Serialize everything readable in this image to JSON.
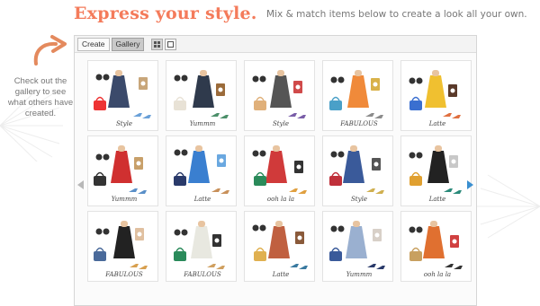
{
  "header": {
    "headline": "Express your style.",
    "subhead": "Mix & match items below to create a look all your own."
  },
  "sidebar": {
    "note": "Check out the gallery to see what others have created."
  },
  "toolbar": {
    "tabs": [
      {
        "label": "Create",
        "active": false
      },
      {
        "label": "Gallery",
        "active": true
      }
    ],
    "view_buttons": [
      {
        "icon": "grid-view-icon",
        "active": true
      },
      {
        "icon": "single-view-icon",
        "active": false
      }
    ]
  },
  "gallery": {
    "rows": 3,
    "columns": 5,
    "items": [
      {
        "icon": "outfit-thumbnail-1",
        "caption": "Style"
      },
      {
        "icon": "outfit-thumbnail-2",
        "caption": "Yummm"
      },
      {
        "icon": "outfit-thumbnail-3",
        "caption": "Style"
      },
      {
        "icon": "outfit-thumbnail-4",
        "caption": "FABULOUS"
      },
      {
        "icon": "outfit-thumbnail-5",
        "caption": "Latte"
      },
      {
        "icon": "outfit-thumbnail-6",
        "caption": "Yummm"
      },
      {
        "icon": "outfit-thumbnail-7",
        "caption": "Latte"
      },
      {
        "icon": "outfit-thumbnail-8",
        "caption": "ooh la la"
      },
      {
        "icon": "outfit-thumbnail-9",
        "caption": "Style"
      },
      {
        "icon": "outfit-thumbnail-10",
        "caption": "Latte"
      },
      {
        "icon": "outfit-thumbnail-11",
        "caption": "FABULOUS"
      },
      {
        "icon": "outfit-thumbnail-12",
        "caption": "FABULOUS"
      },
      {
        "icon": "outfit-thumbnail-13",
        "caption": "Latte"
      },
      {
        "icon": "outfit-thumbnail-14",
        "caption": "Yummm"
      },
      {
        "icon": "outfit-thumbnail-15",
        "caption": "ooh la la"
      }
    ]
  },
  "nav": {
    "prev_icon": "arrow-left-icon",
    "next_icon": "arrow-right-icon"
  },
  "colors": {
    "headline": "#f47b5b",
    "nav_arrow": "#3a8fd0",
    "body_text": "#777777"
  }
}
